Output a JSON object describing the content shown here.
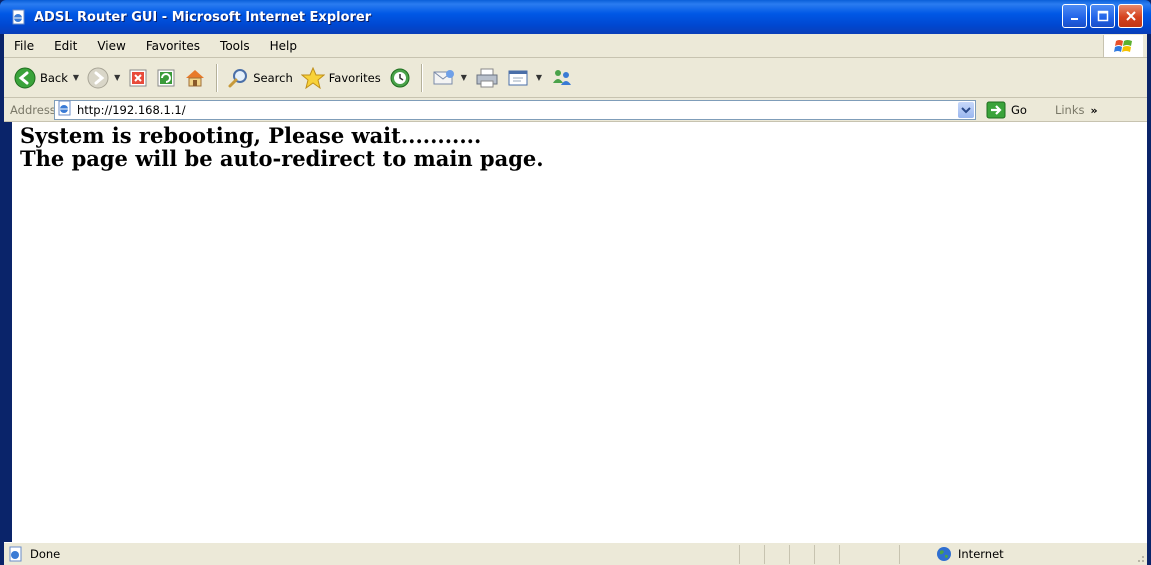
{
  "window": {
    "title": "ADSL Router GUI - Microsoft Internet Explorer"
  },
  "menu": {
    "items": [
      "File",
      "Edit",
      "View",
      "Favorites",
      "Tools",
      "Help"
    ]
  },
  "toolbar": {
    "back_label": "Back",
    "search_label": "Search",
    "favorites_label": "Favorites"
  },
  "address": {
    "label": "Address",
    "url": "http://192.168.1.1/",
    "go_label": "Go",
    "links_label": "Links",
    "links_more": "»"
  },
  "content": {
    "line1": "System is rebooting, Please wait...........",
    "line2": "The page will be auto-redirect to main page."
  },
  "status": {
    "text": "Done",
    "zone": "Internet"
  },
  "colors": {
    "titlebar": "#0058e6",
    "chrome": "#ece9d8",
    "close_button": "#d5431f"
  }
}
